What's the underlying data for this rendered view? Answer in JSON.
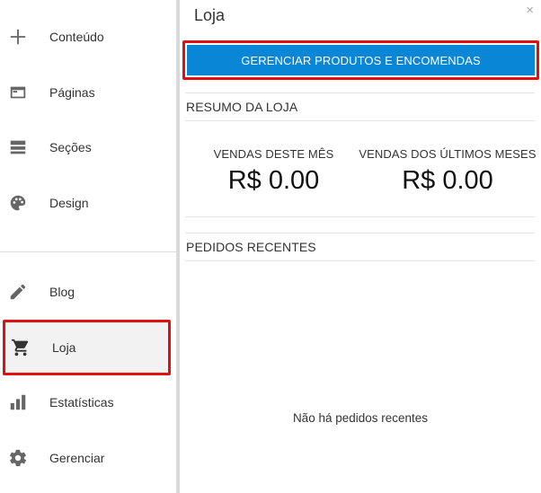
{
  "sidebar": {
    "items": [
      {
        "label": "Conteúdo",
        "icon": "plus-icon"
      },
      {
        "label": "Páginas",
        "icon": "pages-icon"
      },
      {
        "label": "Seções",
        "icon": "sections-icon"
      },
      {
        "label": "Design",
        "icon": "palette-icon"
      },
      {
        "label": "Blog",
        "icon": "pencil-icon"
      },
      {
        "label": "Loja",
        "icon": "cart-icon"
      },
      {
        "label": "Estatísticas",
        "icon": "bar-chart-icon"
      },
      {
        "label": "Gerenciar",
        "icon": "gear-icon"
      }
    ],
    "active_item": "Loja"
  },
  "panel": {
    "title": "Loja",
    "close_label": "×",
    "manage_button": "GERENCIAR PRODUTOS E ENCOMENDAS",
    "summary_title": "RESUMO DA LOJA",
    "stats": [
      {
        "label": "VENDAS DESTE MÊS",
        "value": "R$ 0.00"
      },
      {
        "label": "VENDAS DOS ÚLTIMOS MESES",
        "value": "R$ 0.00"
      }
    ],
    "recent_orders_title": "PEDIDOS RECENTES",
    "empty_message": "Não há pedidos recentes"
  },
  "colors": {
    "accent": "#0a86d6",
    "highlight": "#e01010",
    "icon": "#666666"
  }
}
